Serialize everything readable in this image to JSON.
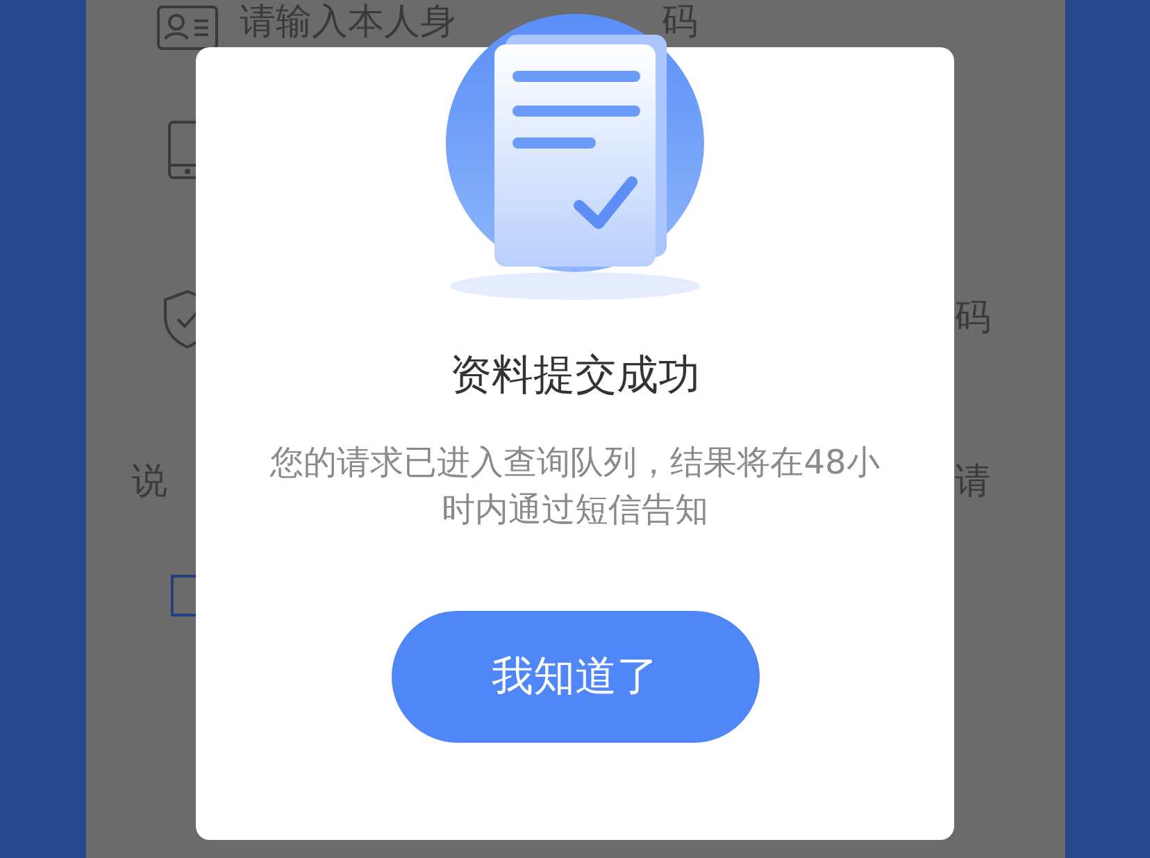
{
  "background_form": {
    "rows": [
      {
        "kind": "id",
        "left": "请输入本人身",
        "right": "码"
      },
      {
        "kind": "phone"
      },
      {
        "kind": "shield",
        "left": "",
        "right": "码"
      },
      {
        "kind": "note",
        "left": "说",
        "right": "请"
      }
    ]
  },
  "dialog": {
    "title": "资料提交成功",
    "message": "您的请求已进入查询队列，结果将在48小时内通过短信告知",
    "button": "我知道了"
  }
}
